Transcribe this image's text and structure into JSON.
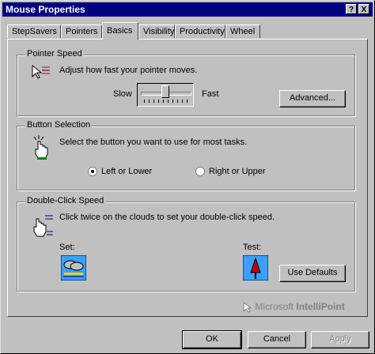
{
  "window": {
    "title": "Mouse Properties",
    "help_label": "?",
    "close_label": "X"
  },
  "tabs": [
    {
      "label": "StepSavers"
    },
    {
      "label": "Pointers"
    },
    {
      "label": "Basics"
    },
    {
      "label": "Visibility"
    },
    {
      "label": "Productivity"
    },
    {
      "label": "Wheel"
    }
  ],
  "pointer_speed": {
    "legend": "Pointer Speed",
    "description": "Adjust how fast your pointer moves.",
    "slow_label": "Slow",
    "fast_label": "Fast",
    "speed_level": 0.5,
    "advanced_button": "Advanced..."
  },
  "button_selection": {
    "legend": "Button Selection",
    "description": "Select the button you want to use for most tasks.",
    "option_left": "Left or Lower",
    "option_right": "Right or Upper",
    "selected": "Left or Lower"
  },
  "double_click": {
    "legend": "Double-Click Speed",
    "description": "Click twice on the clouds to set your double-click speed.",
    "set_label": "Set:",
    "test_label": "Test:",
    "use_defaults_button": "Use Defaults"
  },
  "branding": {
    "brand_light": "Microsoft ",
    "brand_bold": "IntelliPoint"
  },
  "footer": {
    "ok_button": "OK",
    "cancel_button": "Cancel",
    "apply_button": "Apply"
  }
}
